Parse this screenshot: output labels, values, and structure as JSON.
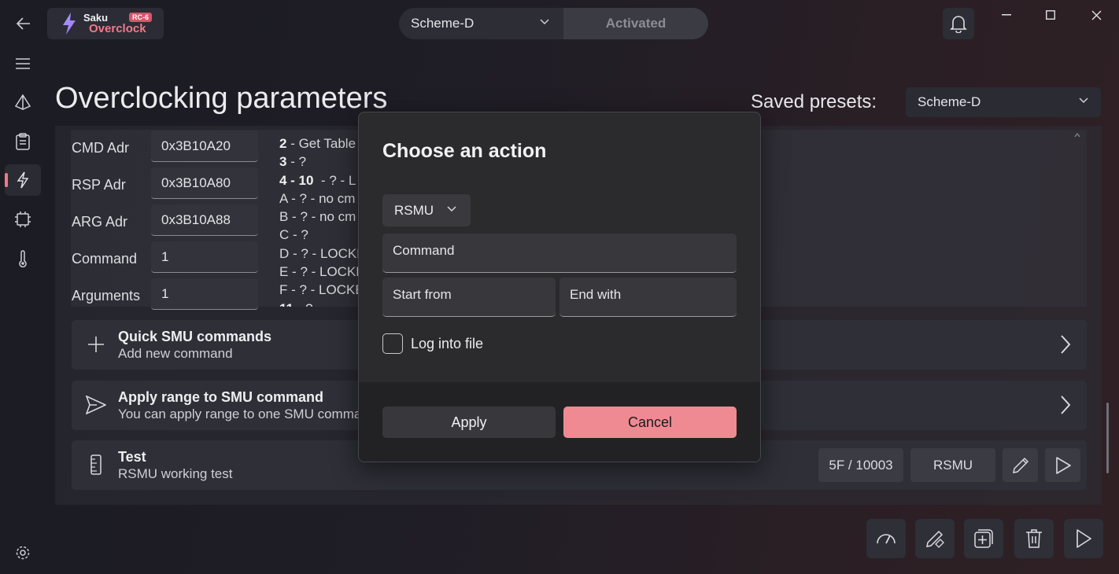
{
  "app": {
    "logo_top": "Saku",
    "logo_bottom": "Overclock",
    "version_badge": "RC-6"
  },
  "topbar": {
    "scheme_selected": "Scheme-D",
    "status_label": "Activated"
  },
  "header": {
    "title": "Overclocking parameters",
    "saved_presets_label": "Saved presets:",
    "saved_presets_value": "Scheme-D"
  },
  "registers": [
    {
      "label": "CMD Adr",
      "value": "0x3B10A20"
    },
    {
      "label": "RSP Adr",
      "value": "0x3B10A80"
    },
    {
      "label": "ARG Adr",
      "value": "0x3B10A88"
    },
    {
      "label": "Command",
      "value": "1"
    },
    {
      "label": "Arguments",
      "value": "1"
    }
  ],
  "info_lines": [
    {
      "key": "2",
      "text": " - Get Table"
    },
    {
      "key": "3",
      "text": " - ?"
    },
    {
      "key": "4 - 10",
      "text": "  - ? - L"
    },
    {
      "key": "",
      "text": "A - ? - no cm"
    },
    {
      "key": "",
      "text": "B - ? - no cm"
    },
    {
      "key": "",
      "text": "C - ?"
    },
    {
      "key": "",
      "text": "D - ? - LOCKE"
    },
    {
      "key": "",
      "text": "E - ? - LOCKE"
    },
    {
      "key": "",
      "text": "F - ? - LOCKE"
    },
    {
      "key": "11",
      "text": " - ?"
    }
  ],
  "cards": {
    "quick": {
      "title": "Quick SMU commands",
      "subtitle": "Add new command"
    },
    "range": {
      "title": "Apply range to SMU command",
      "subtitle": "You can apply range to one SMU comman"
    },
    "test": {
      "title": "Test",
      "subtitle": "RSMU working test",
      "value_pill": "5F / 10003",
      "mailbox_pill": "RSMU"
    }
  },
  "dialog": {
    "title": "Choose an action",
    "mailbox_selected": "RSMU",
    "command_placeholder": "Command",
    "start_placeholder": "Start from",
    "end_placeholder": "End with",
    "log_label": "Log into file",
    "apply_label": "Apply",
    "cancel_label": "Cancel"
  },
  "colors": {
    "accent": "#ef7b88",
    "cancel_button": "#ef8a92"
  }
}
